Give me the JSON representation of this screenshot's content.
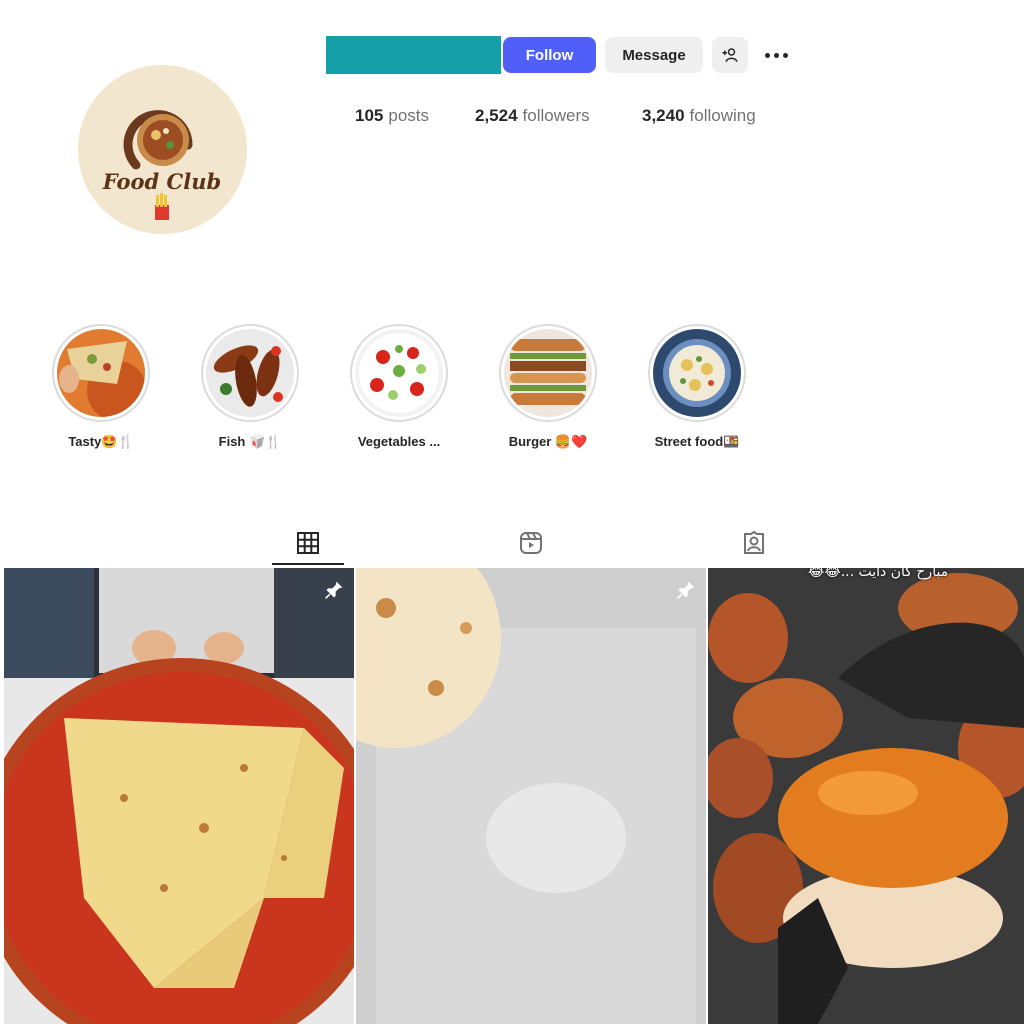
{
  "profile": {
    "avatar_logo_text": "Food Club",
    "follow_label": "Follow",
    "message_label": "Message",
    "stats": {
      "posts_count": "105",
      "posts_label": "posts",
      "followers_count": "2,524",
      "followers_label": "followers",
      "following_count": "3,240",
      "following_label": "following"
    },
    "colors": {
      "username_bar": "#14a0a6",
      "follow_button": "#4f5ff7"
    }
  },
  "highlights": [
    {
      "label": "Tasty🤩🍴"
    },
    {
      "label": "Fish 🥡🍴"
    },
    {
      "label": "Vegetables ..."
    },
    {
      "label": "Burger 🍔❤️"
    },
    {
      "label": "Street food🍱"
    }
  ],
  "tabs": [
    {
      "icon": "grid-icon",
      "active": true
    },
    {
      "icon": "reels-icon",
      "active": false
    },
    {
      "icon": "tagged-icon",
      "active": false
    }
  ],
  "posts": [
    {
      "subject": "pizza",
      "pinned": true
    },
    {
      "subject": "flatbread",
      "pinned": true
    },
    {
      "subject": "burger",
      "pinned": false,
      "overlay_text": "مبارح كان دايت ...😂😂"
    }
  ]
}
